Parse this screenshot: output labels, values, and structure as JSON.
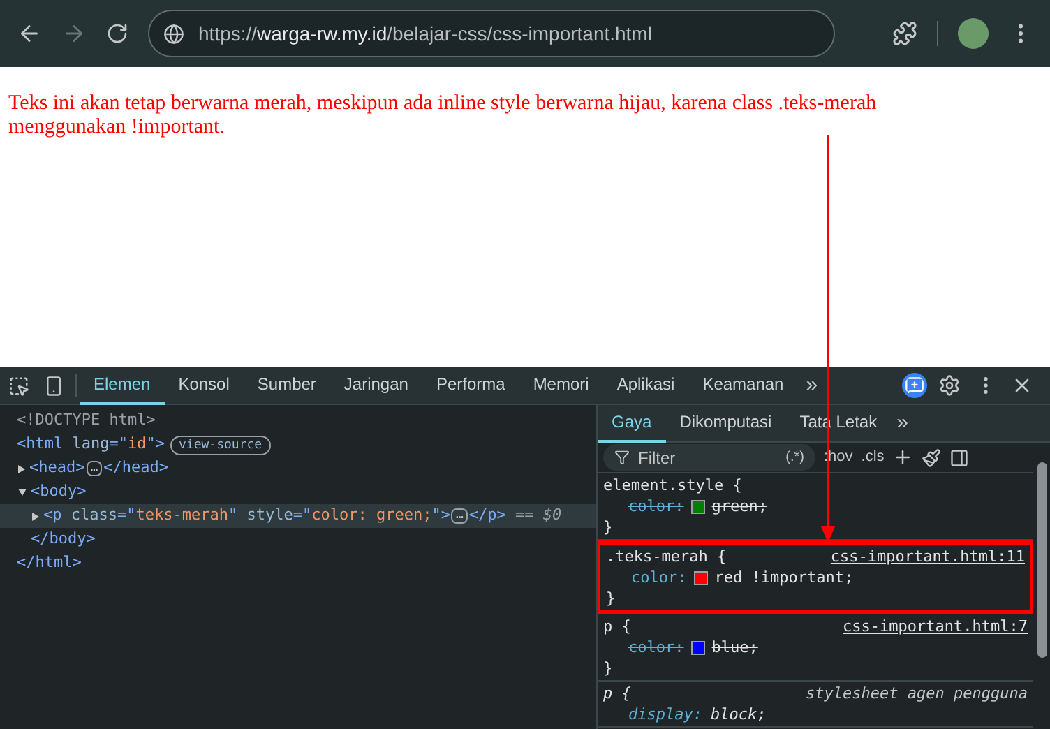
{
  "browser": {
    "url": [
      {
        "text": "https://",
        "kind": "dim"
      },
      {
        "text": "warga-rw.my.id",
        "kind": "host"
      },
      {
        "text": "/belajar-css/css-important.html",
        "kind": "dim"
      }
    ],
    "forward_disabled": true
  },
  "page": {
    "paragraph": "Teks ini akan tetap berwarna merah, meskipun ada inline style berwarna hijau, karena class .teks-merah menggunakan !important."
  },
  "devtools": {
    "tabs": [
      {
        "label": "Elemen",
        "selected": true
      },
      {
        "label": "Konsol",
        "selected": false
      },
      {
        "label": "Sumber",
        "selected": false
      },
      {
        "label": "Jaringan",
        "selected": false
      },
      {
        "label": "Performa",
        "selected": false
      },
      {
        "label": "Memori",
        "selected": false
      },
      {
        "label": "Aplikasi",
        "selected": false
      },
      {
        "label": "Keamanan",
        "selected": false
      }
    ],
    "more_tabs": "»",
    "tree": [
      {
        "tokens": [
          {
            "text": "<!DOCTYPE html>",
            "kind": "doctype"
          }
        ],
        "selected": false
      },
      {
        "tokens": [
          {
            "text": "<html",
            "kind": "tag"
          },
          {
            "text": " lang",
            "kind": "attr"
          },
          {
            "text": "=\"",
            "kind": "tag"
          },
          {
            "text": "id",
            "kind": "value"
          },
          {
            "text": "\">",
            "kind": "tag"
          }
        ],
        "badge": "view-source",
        "selected": false,
        "children": [
          {
            "tokens": [
              {
                "text": "<head>",
                "kind": "tag"
              },
              {
                "text": "…",
                "kind": "ellipsis"
              },
              {
                "text": "</head>",
                "kind": "tag"
              }
            ],
            "expanded": false,
            "selected": false
          },
          {
            "tokens": [
              {
                "text": "<body>",
                "kind": "tag"
              }
            ],
            "expanded": true,
            "selected": false,
            "children": [
              {
                "tokens": [
                  {
                    "text": "<p",
                    "kind": "tag"
                  },
                  {
                    "text": " class",
                    "kind": "attr"
                  },
                  {
                    "text": "=\"",
                    "kind": "tag"
                  },
                  {
                    "text": "teks-merah",
                    "kind": "value"
                  },
                  {
                    "text": "\"",
                    "kind": "tag"
                  },
                  {
                    "text": " style",
                    "kind": "attr"
                  },
                  {
                    "text": "=\"",
                    "kind": "tag"
                  },
                  {
                    "text": "color: green;",
                    "kind": "value"
                  },
                  {
                    "text": "\">",
                    "kind": "tag"
                  },
                  {
                    "text": "…",
                    "kind": "ellipsis"
                  },
                  {
                    "text": "</p>",
                    "kind": "tag"
                  },
                  {
                    "text": " == $0",
                    "kind": "ref"
                  }
                ],
                "expanded": false,
                "selected": true
              }
            ]
          },
          {
            "tokens": [
              {
                "text": "</body>",
                "kind": "tag"
              }
            ],
            "selected": false
          }
        ]
      },
      {
        "tokens": [
          {
            "text": "</html>",
            "kind": "tag"
          }
        ],
        "selected": false
      }
    ],
    "side_tabs": [
      {
        "label": "Gaya",
        "selected": true
      },
      {
        "label": "Dikomputasi",
        "selected": false
      },
      {
        "label": "Tata Letak",
        "selected": false
      }
    ],
    "side_more": "»",
    "filter": {
      "placeholder": "Filter",
      "regex": "(.*)"
    },
    "toolbar": [
      ":hov",
      ".cls"
    ],
    "rules": [
      {
        "selector": "element.style {",
        "kind": "inline",
        "highlighted": false,
        "declarations": [
          {
            "property": "color:",
            "value": "green;",
            "color": "#008000",
            "overridden": true
          }
        ],
        "close": "}"
      },
      {
        "selector": ".teks-merah {",
        "source": "css-important.html:11",
        "kind": "author",
        "highlighted": true,
        "declarations": [
          {
            "property": "color:",
            "value": "red !important;",
            "color": "#ff0000",
            "overridden": false
          }
        ],
        "close": "}"
      },
      {
        "selector": "p {",
        "source": "css-important.html:7",
        "kind": "author",
        "highlighted": false,
        "declarations": [
          {
            "property": "color:",
            "value": "blue;",
            "color": "#0000ff",
            "overridden": true
          }
        ],
        "close": "}"
      },
      {
        "selector": "p {",
        "source": "stylesheet agen pengguna",
        "kind": "agent",
        "highlighted": false,
        "declarations": [
          {
            "property": "display:",
            "value": "block;",
            "overridden": false
          }
        ]
      }
    ]
  }
}
